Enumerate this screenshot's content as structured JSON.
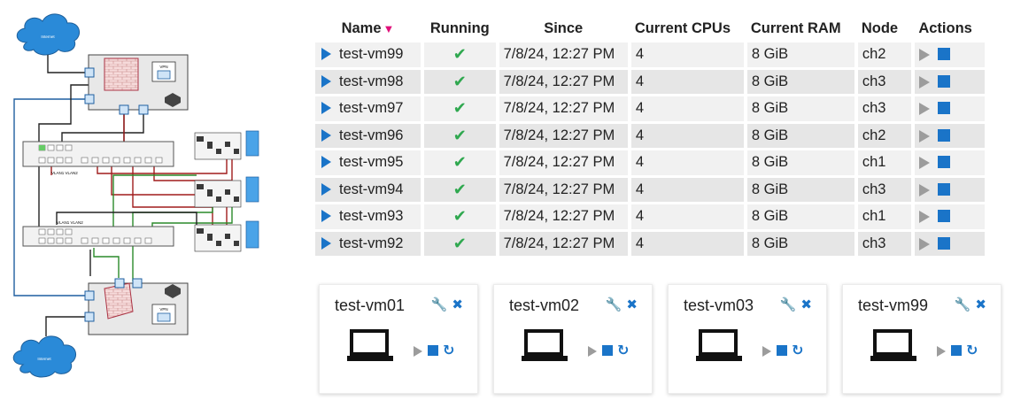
{
  "vm_table": {
    "headers": {
      "name": "Name",
      "running": "Running",
      "since": "Since",
      "cpus": "Current CPUs",
      "ram": "Current RAM",
      "node": "Node",
      "actions": "Actions"
    },
    "sort_indicator": "▼",
    "rows": [
      {
        "name": "test-vm99",
        "since": "7/8/24, 12:27 PM",
        "cpus": "4",
        "ram": "8 GiB",
        "node": "ch2"
      },
      {
        "name": "test-vm98",
        "since": "7/8/24, 12:27 PM",
        "cpus": "4",
        "ram": "8 GiB",
        "node": "ch3"
      },
      {
        "name": "test-vm97",
        "since": "7/8/24, 12:27 PM",
        "cpus": "4",
        "ram": "8 GiB",
        "node": "ch3"
      },
      {
        "name": "test-vm96",
        "since": "7/8/24, 12:27 PM",
        "cpus": "4",
        "ram": "8 GiB",
        "node": "ch2"
      },
      {
        "name": "test-vm95",
        "since": "7/8/24, 12:27 PM",
        "cpus": "4",
        "ram": "8 GiB",
        "node": "ch1"
      },
      {
        "name": "test-vm94",
        "since": "7/8/24, 12:27 PM",
        "cpus": "4",
        "ram": "8 GiB",
        "node": "ch3"
      },
      {
        "name": "test-vm93",
        "since": "7/8/24, 12:27 PM",
        "cpus": "4",
        "ram": "8 GiB",
        "node": "ch1"
      },
      {
        "name": "test-vm92",
        "since": "7/8/24, 12:27 PM",
        "cpus": "4",
        "ram": "8 GiB",
        "node": "ch3"
      }
    ]
  },
  "cards": [
    {
      "name": "test-vm01"
    },
    {
      "name": "test-vm02"
    },
    {
      "name": "test-vm03"
    },
    {
      "name": "test-vm99"
    }
  ],
  "diagram": {
    "internet_label": "Internet",
    "vpn_label": "VPN",
    "vlan_label": "VLAN1 VLAN2"
  },
  "icons": {
    "expand": "expand-triangle-icon",
    "running": "checkmark-icon",
    "start": "play-icon",
    "stop": "stop-icon",
    "settings": "wrench-icon",
    "remove": "close-icon",
    "restart": "restart-icon",
    "vm": "laptop-icon"
  },
  "colors": {
    "accent": "#1a74c8",
    "running": "#2fa84f",
    "sort": "#e0107a",
    "disabled": "#9c9c9c",
    "row_even": "#f1f1f1",
    "row_odd": "#e6e6e6"
  }
}
